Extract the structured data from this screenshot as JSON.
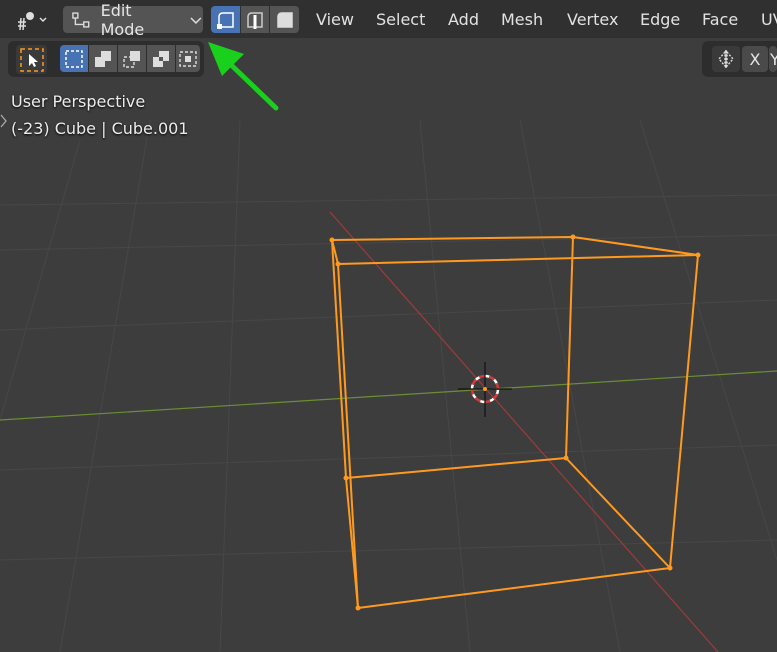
{
  "header": {
    "mode_dropdown": "Edit Mode",
    "menus": [
      "View",
      "Select",
      "Add",
      "Mesh",
      "Vertex",
      "Edge",
      "Face",
      "UV"
    ]
  },
  "overlay": {
    "view_name": "User Perspective",
    "object_info": "(-23) Cube | Cube.001"
  },
  "axis_buttons": {
    "x": "X",
    "y": "Y"
  },
  "colors": {
    "background": "#3d3d3d",
    "header": "#303030",
    "accent_blue": "#4772b3",
    "wire_orange": "#ff9a1f",
    "axis_x": "#a23a3a",
    "axis_y": "#6a8f33",
    "arrow_green": "#19d11d"
  },
  "icons": {
    "editor_type": "object-tools-icon",
    "mode": "edit-mode-icon",
    "select_modes": [
      "vertex-select-icon",
      "edge-select-icon",
      "face-select-icon"
    ],
    "tool": "select-box-tool-icon",
    "selection_ops": [
      "set-new-icon",
      "extend-icon",
      "subtract-icon",
      "difference-icon",
      "intersect-icon"
    ],
    "mirror": "mirror-icon"
  }
}
